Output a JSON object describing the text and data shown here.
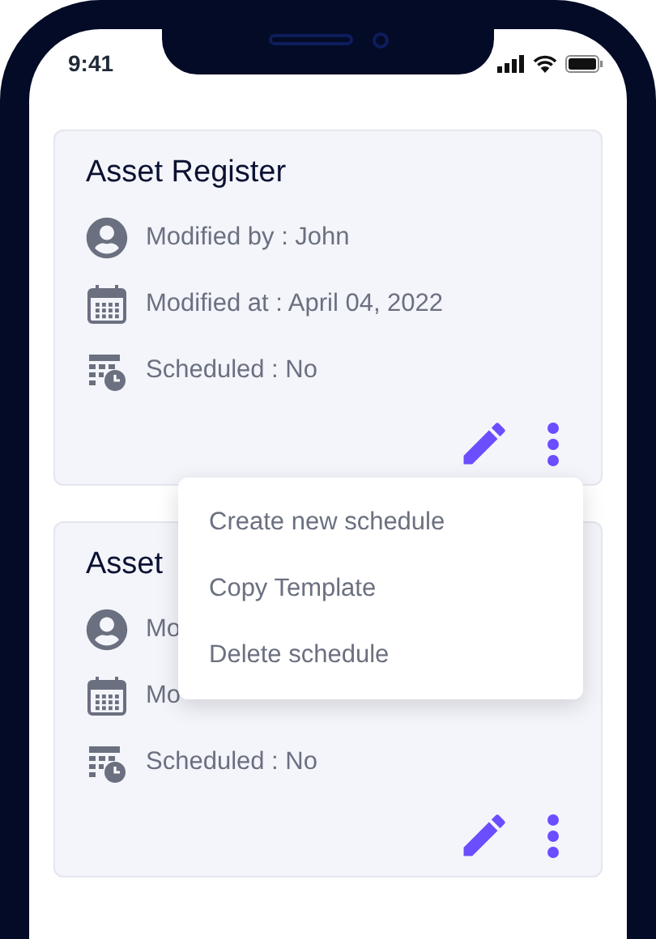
{
  "status_bar": {
    "time": "9:41"
  },
  "cards": [
    {
      "title": "Asset Register",
      "rows": [
        {
          "kind": "user",
          "text": "Modified by : John"
        },
        {
          "kind": "calendar",
          "text": "Modified at : April 04, 2022"
        },
        {
          "kind": "schedule",
          "text": "Scheduled : No"
        }
      ]
    },
    {
      "title": "Asset",
      "rows": [
        {
          "kind": "user",
          "text": "Mo"
        },
        {
          "kind": "calendar",
          "text": "Mo"
        },
        {
          "kind": "schedule",
          "text": "Scheduled : No"
        }
      ]
    }
  ],
  "menu": {
    "items": [
      "Create new schedule",
      "Copy Template",
      "Delete schedule"
    ]
  }
}
